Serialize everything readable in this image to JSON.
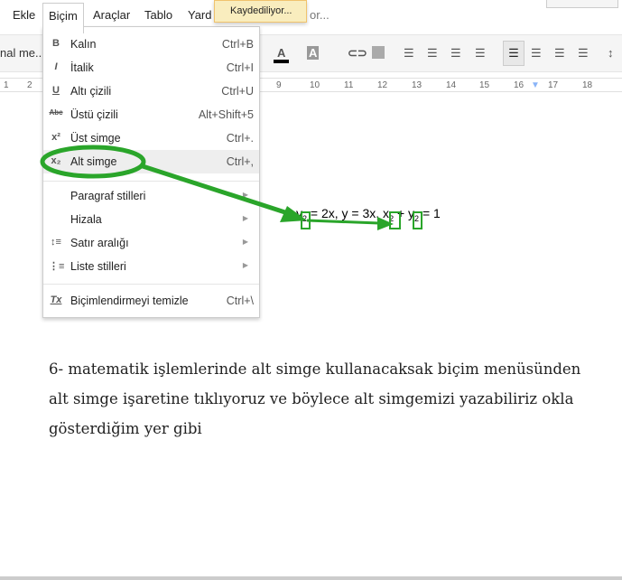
{
  "menubar": {
    "items": [
      "Ekle",
      "Biçim",
      "Araçlar",
      "Tablo",
      "Yard"
    ],
    "trailing": "or...",
    "saving": "Kaydediliyor..."
  },
  "toolbar": {
    "style": "nal me..."
  },
  "ruler": {
    "ticks": [
      "1",
      "2",
      "9",
      "10",
      "11",
      "12",
      "13",
      "14",
      "15",
      "16",
      "17",
      "18"
    ]
  },
  "format_menu": {
    "items": [
      {
        "icon": "bold-icon",
        "glyph": "B",
        "label": "Kalın",
        "shortcut": "Ctrl+B"
      },
      {
        "icon": "italic-icon",
        "glyph": "I",
        "label": "İtalik",
        "shortcut": "Ctrl+I"
      },
      {
        "icon": "underline-icon",
        "glyph": "U",
        "label": "Altı çizili",
        "shortcut": "Ctrl+U"
      },
      {
        "icon": "strikethrough-icon",
        "glyph": "Abc",
        "label": "Üstü çizili",
        "shortcut": "Alt+Shift+5"
      },
      {
        "icon": "superscript-icon",
        "glyph": "x²",
        "label": "Üst simge",
        "shortcut": "Ctrl+."
      },
      {
        "icon": "subscript-icon",
        "glyph": "x₂",
        "label": "Alt simge",
        "shortcut": "Ctrl+,"
      },
      {
        "label": "Paragraf stilleri"
      },
      {
        "label": "Hizala"
      },
      {
        "icon": "line-spacing-icon",
        "glyph": "↕≡",
        "label": "Satır aralığı"
      },
      {
        "icon": "list-icon",
        "glyph": "⋮≡",
        "label": "Liste stilleri"
      },
      {
        "icon": "clear-formatting-icon",
        "glyph": "Tx",
        "label": "Biçimlendirmeyi temizle",
        "shortcut": "Ctrl+\\"
      }
    ]
  },
  "document": {
    "equation": {
      "y": "y",
      "s1": "2",
      "mid": " = 2x, y = 3x, x",
      "s2": "2",
      "mid2": " + y",
      "s3": "2",
      "end": " = 1"
    },
    "lines": [
      "6- matematik işlemlerinde alt simge kullanacaksak biçim menüsünden",
      "alt simge işaretine tıklıyoruz ve böylece alt simgemizi yazabiliriz okla",
      "gösterdiğim yer gibi"
    ]
  },
  "annotation_color": "#2aa52a"
}
